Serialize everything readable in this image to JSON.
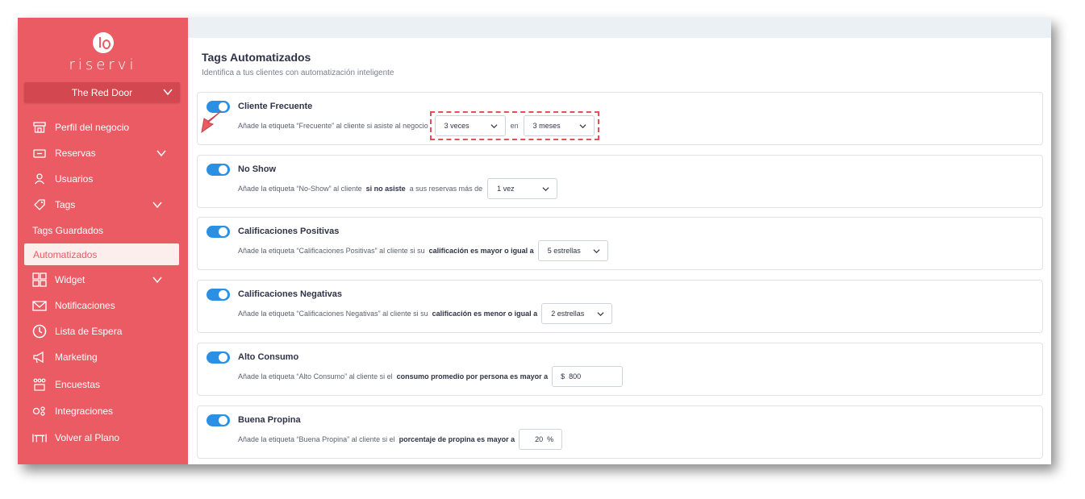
{
  "brand": {
    "name": "riservi",
    "venue": "The Red Door"
  },
  "sidebar": {
    "items": [
      {
        "label": "Perfil del negocio",
        "icon": "storefront-icon"
      },
      {
        "label": "Reservas",
        "icon": "ticket-icon",
        "expandable": true
      },
      {
        "label": "Usuarios",
        "icon": "user-icon"
      },
      {
        "label": "Tags",
        "icon": "tag-icon",
        "expandable": true
      },
      {
        "label": "Tags Guardados",
        "sub": true
      },
      {
        "label": "Automatizados",
        "sub": true,
        "active": true
      },
      {
        "label": "Widget",
        "icon": "widget-grid-icon",
        "expandable": true
      },
      {
        "label": "Notificaciones",
        "icon": "envelope-icon"
      },
      {
        "label": "Lista de Espera",
        "icon": "clock-icon"
      },
      {
        "label": "Marketing",
        "icon": "megaphone-icon"
      },
      {
        "label": "Encuestas",
        "icon": "survey-icon"
      },
      {
        "label": "Integraciones",
        "icon": "integrations-icon"
      },
      {
        "label": "Volver al Plano",
        "icon": "table-icon"
      }
    ]
  },
  "page": {
    "title": "Tags Automatizados",
    "subtitle": "Identifica a tus clientes con automatización inteligente"
  },
  "cards": [
    {
      "title": "Cliente Frecuente",
      "enabled": true,
      "text": "Añade la etiqueta “Frecuente” al cliente si asiste al negocio",
      "select1": "3 veces",
      "connector": "en",
      "select2": "3 meses"
    },
    {
      "title": "No Show",
      "enabled": true,
      "text": "Añade la etiqueta “No-Show” al cliente",
      "bold": "si no asiste",
      "text2": "a sus reservas más de",
      "select1": "1 vez"
    },
    {
      "title": "Calificaciones Positivas",
      "enabled": true,
      "text": "Añade la etiqueta “Calificaciones Positivas” al cliente si su",
      "bold": "calificación es mayor o igual a",
      "select1": "5 estrellas"
    },
    {
      "title": "Calificaciones Negativas",
      "enabled": true,
      "text": "Añade la etiqueta “Calificaciones Negativas” al cliente si su",
      "bold": "calificación es menor o igual a",
      "select1": "2 estrellas"
    },
    {
      "title": "Alto Consumo",
      "enabled": true,
      "text": "Añade la etiqueta “Alto Consumo” al cliente si el",
      "bold": "consumo promedio por persona es mayor a",
      "input": "$  800"
    },
    {
      "title": "Buena Propina",
      "enabled": true,
      "text": "Añade la etiqueta “Buena Propina” al cliente si el",
      "bold": "porcentaje de propina es mayor a",
      "input": "20  %"
    }
  ],
  "colors": {
    "sidebar": "#ea5b63",
    "toggle": "#2b8fe4",
    "highlight": "#e0515a"
  }
}
